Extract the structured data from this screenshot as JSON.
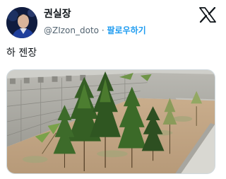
{
  "tweet": {
    "author_name": "권실장",
    "handle": "@ZIzon_doto",
    "separator": "·",
    "follow_label": "팔로우하기",
    "text": "하 젠장"
  },
  "colors": {
    "follow_blue": "#1d9bf0",
    "secondary_text": "#536471",
    "primary_text": "#0f1419"
  },
  "icons": {
    "brand": "x-logo-icon"
  }
}
